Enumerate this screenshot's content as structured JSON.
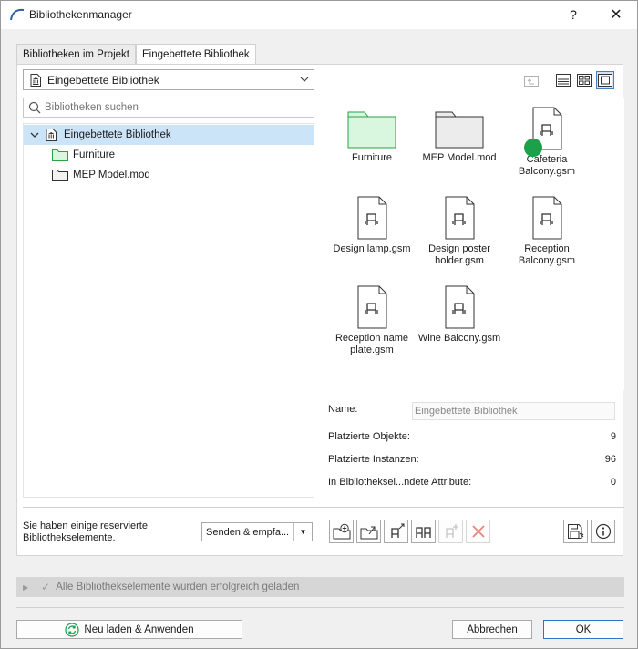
{
  "window": {
    "title": "Bibliothekenmanager",
    "help_label": "?",
    "close_label": "✕"
  },
  "tabs": [
    {
      "label": "Bibliotheken im Projekt",
      "active": false
    },
    {
      "label": "Eingebettete Bibliothek",
      "active": true
    }
  ],
  "library_select": {
    "value": "Eingebettete Bibliothek"
  },
  "search": {
    "placeholder": "Bibliotheken suchen"
  },
  "tree": {
    "root": "Eingebettete Bibliothek",
    "children": [
      "Furniture",
      "MEP Model.mod"
    ]
  },
  "grid": {
    "items": [
      {
        "label": "Furniture",
        "icon": "folder-green-icon"
      },
      {
        "label": "MEP Model.mod",
        "icon": "folder-gray-icon"
      },
      {
        "label": "Cafeteria Balcony.gsm",
        "icon": "gsm-file-icon",
        "badge": true
      },
      {
        "label": "Design lamp.gsm",
        "icon": "gsm-file-icon"
      },
      {
        "label": "Design poster holder.gsm",
        "icon": "gsm-file-icon"
      },
      {
        "label": "Reception Balcony.gsm",
        "icon": "gsm-file-icon"
      },
      {
        "label": "Reception name plate.gsm",
        "icon": "gsm-file-icon"
      },
      {
        "label": "Wine Balcony.gsm",
        "icon": "gsm-file-icon"
      }
    ]
  },
  "info": {
    "name_label": "Name:",
    "name_value": "Eingebettete Bibliothek",
    "placed_objects_label": "Platzierte Objekte:",
    "placed_objects_value": "9",
    "placed_instances_label": "Platzierte Instanzen:",
    "placed_instances_value": "96",
    "attributes_label": "In Bibliotheksel...ndete Attribute:",
    "attributes_value": "0"
  },
  "reserved": {
    "text_line1": "Sie haben einige reservierte",
    "text_line2": "Bibliothekselemente.",
    "send_label": "Senden & empfa..."
  },
  "status": {
    "text": "Alle Bibliothekselemente wurden erfolgreich geladen"
  },
  "buttons": {
    "reload": "Neu laden & Anwenden",
    "cancel": "Abbrechen",
    "ok": "OK"
  },
  "colors": {
    "accent": "#2e73c8",
    "folder_green": "#d9f7df",
    "badge_green": "#1aa14a",
    "delete_red": "#e8857b"
  }
}
